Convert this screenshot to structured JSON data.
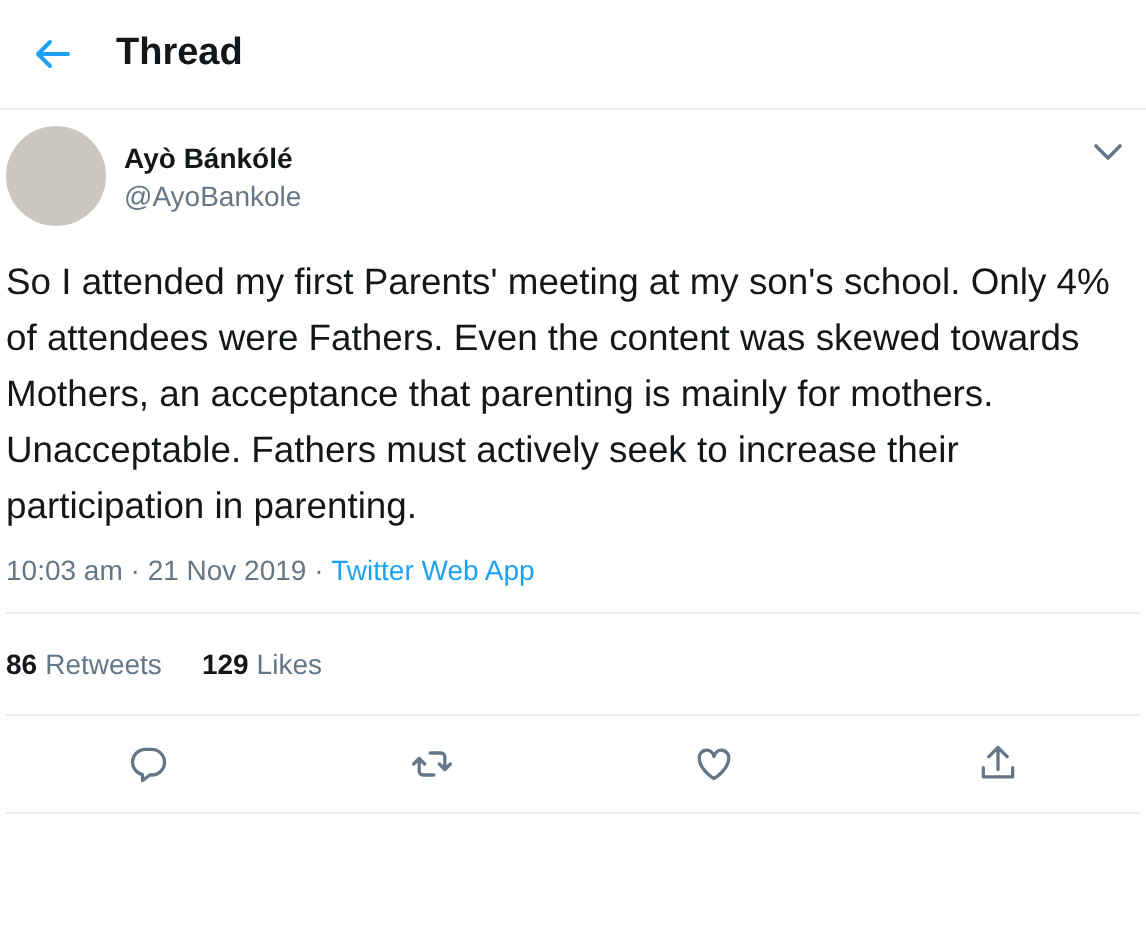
{
  "header": {
    "title": "Thread"
  },
  "tweet": {
    "name": "Ayò Bánkólé",
    "handle": "@AyoBankole",
    "text": "So I attended my first Parents' meeting at my son's school. Only 4% of attendees were Fathers. Even the content was skewed towards Mothers, an acceptance that parenting is mainly for mothers. Unacceptable. Fathers must actively seek to increase their participation in parenting.",
    "time": "10:03 am · 21 Nov 2019 · ",
    "source": "Twitter Web App"
  },
  "stats": [
    {
      "count": "86",
      "label": "Retweets"
    },
    {
      "count": "129",
      "label": "Likes"
    }
  ],
  "actions": [
    {
      "kind": "reply"
    },
    {
      "kind": "retweet"
    },
    {
      "kind": "like"
    },
    {
      "kind": "share"
    }
  ]
}
